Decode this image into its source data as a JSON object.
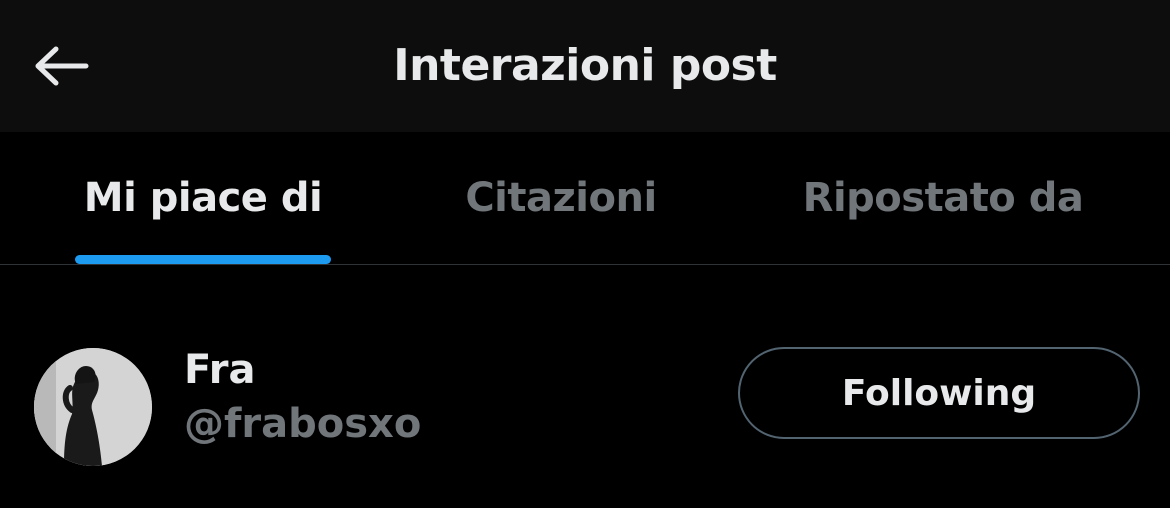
{
  "colors": {
    "accent": "#1d9bf0",
    "primary_text": "#e7e9ea",
    "secondary_text": "#71767b",
    "header_bg": "#0d0d0d",
    "background": "#000000"
  },
  "header": {
    "back_icon": "arrow-left-icon",
    "title": "Interazioni post"
  },
  "tabs": [
    {
      "label": "Mi piace di",
      "active": true
    },
    {
      "label": "Citazioni",
      "active": false
    },
    {
      "label": "Ripostato da",
      "active": false
    }
  ],
  "users": [
    {
      "name": "Fra",
      "handle": "@frabosxo",
      "avatar": "user-avatar-photo",
      "follow_label": "Following"
    }
  ]
}
